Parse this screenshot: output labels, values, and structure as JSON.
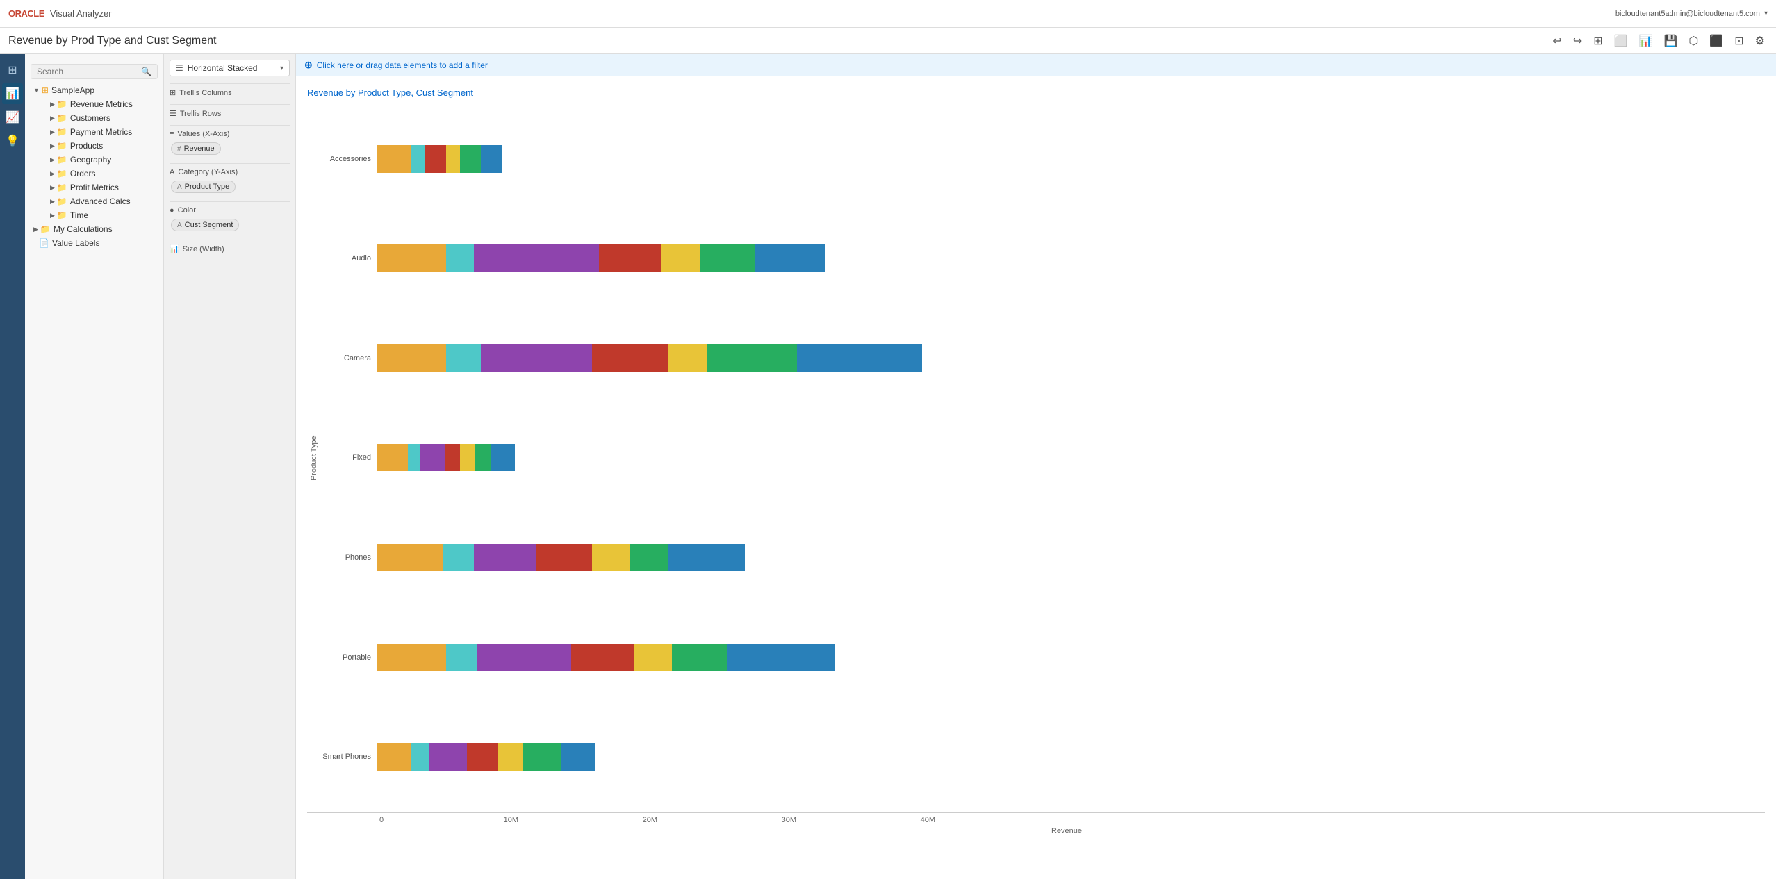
{
  "header": {
    "oracle_label": "ORACLE",
    "app_label": "Visual Analyzer",
    "user_email": "bicloudtenant5admin@bicloudtenant5.com",
    "title": "Revenue by Prod Type and Cust Segment"
  },
  "toolbar_icons": [
    "↩",
    "↪",
    "⊞",
    "⊡",
    "📊",
    "💾",
    "⚙",
    "⬜",
    "⬛",
    "⚙"
  ],
  "filter_bar": {
    "label": "Click here or drag data elements to add a filter"
  },
  "sidebar": {
    "search_placeholder": "Search",
    "root_item": "SampleApp",
    "items": [
      {
        "label": "Revenue Metrics",
        "indent": 1,
        "type": "folder"
      },
      {
        "label": "Customers",
        "indent": 1,
        "type": "folder"
      },
      {
        "label": "Payment Metrics",
        "indent": 1,
        "type": "folder"
      },
      {
        "label": "Products",
        "indent": 1,
        "type": "folder"
      },
      {
        "label": "Geography",
        "indent": 1,
        "type": "folder"
      },
      {
        "label": "Orders",
        "indent": 1,
        "type": "folder"
      },
      {
        "label": "Profit Metrics",
        "indent": 1,
        "type": "folder"
      },
      {
        "label": "Advanced Calcs",
        "indent": 1,
        "type": "folder"
      },
      {
        "label": "Time",
        "indent": 1,
        "type": "folder"
      },
      {
        "label": "My Calculations",
        "indent": 0,
        "type": "folder"
      },
      {
        "label": "Value Labels",
        "indent": 0,
        "type": "item"
      }
    ]
  },
  "grammar": {
    "chart_type": "Horizontal Stacked",
    "sections": [
      {
        "id": "trellis_columns",
        "icon": "⊞",
        "label": "Trellis Columns"
      },
      {
        "id": "trellis_rows",
        "icon": "☰",
        "label": "Trellis Rows"
      },
      {
        "id": "values_xaxis",
        "icon": "≡",
        "label": "Values (X-Axis)",
        "pill": "Revenue",
        "pill_icon": "#"
      },
      {
        "id": "category_yaxis",
        "icon": "A",
        "label": "Category (Y-Axis)",
        "pill": "Product Type",
        "pill_icon": "A"
      },
      {
        "id": "color",
        "icon": "●",
        "label": "Color",
        "pill": "Cust Segment",
        "pill_icon": "A"
      },
      {
        "id": "size_width",
        "icon": "📊",
        "label": "Size (Width)"
      }
    ]
  },
  "chart": {
    "title": "Revenue by Product Type, Cust Segment",
    "y_axis_label": "Product Type",
    "x_axis_label": "Revenue",
    "x_axis_ticks": [
      "0",
      "10M",
      "20M",
      "30M",
      "40M"
    ],
    "rows": [
      {
        "label": "Accessories",
        "segments": [
          {
            "color": "#e8a838",
            "width": 4
          },
          {
            "color": "#4ec8c8",
            "width": 2
          },
          {
            "color": "#c0392b",
            "width": 3
          },
          {
            "color": "#e8c438",
            "width": 2
          },
          {
            "color": "#27ae60",
            "width": 3
          },
          {
            "color": "#2980b9",
            "width": 3
          }
        ]
      },
      {
        "label": "Audio",
        "segments": [
          {
            "color": "#e8a838",
            "width": 9
          },
          {
            "color": "#4ec8c8",
            "width": 3
          },
          {
            "color": "#8e44ad",
            "width": 16
          },
          {
            "color": "#c0392b",
            "width": 8
          },
          {
            "color": "#e8c438",
            "width": 5
          },
          {
            "color": "#27ae60",
            "width": 7
          },
          {
            "color": "#2980b9",
            "width": 9
          }
        ]
      },
      {
        "label": "Camera",
        "segments": [
          {
            "color": "#e8a838",
            "width": 9
          },
          {
            "color": "#4ec8c8",
            "width": 4
          },
          {
            "color": "#8e44ad",
            "width": 14
          },
          {
            "color": "#c0392b",
            "width": 10
          },
          {
            "color": "#e8c438",
            "width": 5
          },
          {
            "color": "#27ae60",
            "width": 12
          },
          {
            "color": "#2980b9",
            "width": 16
          }
        ]
      },
      {
        "label": "Fixed",
        "segments": [
          {
            "color": "#e8a838",
            "width": 4
          },
          {
            "color": "#4ec8c8",
            "width": 2
          },
          {
            "color": "#8e44ad",
            "width": 3
          },
          {
            "color": "#c0392b",
            "width": 2
          },
          {
            "color": "#e8c438",
            "width": 2
          },
          {
            "color": "#27ae60",
            "width": 2
          },
          {
            "color": "#2980b9",
            "width": 3
          }
        ]
      },
      {
        "label": "Phones",
        "segments": [
          {
            "color": "#e8a838",
            "width": 9
          },
          {
            "color": "#4ec8c8",
            "width": 4
          },
          {
            "color": "#8e44ad",
            "width": 8
          },
          {
            "color": "#c0392b",
            "width": 7
          },
          {
            "color": "#e8c438",
            "width": 5
          },
          {
            "color": "#27ae60",
            "width": 5
          },
          {
            "color": "#2980b9",
            "width": 10
          }
        ]
      },
      {
        "label": "Portable",
        "segments": [
          {
            "color": "#e8a838",
            "width": 9
          },
          {
            "color": "#4ec8c8",
            "width": 4
          },
          {
            "color": "#8e44ad",
            "width": 12
          },
          {
            "color": "#c0392b",
            "width": 8
          },
          {
            "color": "#e8c438",
            "width": 5
          },
          {
            "color": "#27ae60",
            "width": 7
          },
          {
            "color": "#2980b9",
            "width": 14
          }
        ]
      },
      {
        "label": "Smart Phones",
        "segments": [
          {
            "color": "#e8a838",
            "width": 4
          },
          {
            "color": "#4ec8c8",
            "width": 2
          },
          {
            "color": "#8e44ad",
            "width": 5
          },
          {
            "color": "#c0392b",
            "width": 4
          },
          {
            "color": "#e8c438",
            "width": 3
          },
          {
            "color": "#27ae60",
            "width": 5
          },
          {
            "color": "#2980b9",
            "width": 4
          }
        ]
      }
    ]
  },
  "left_nav": {
    "icons": [
      {
        "name": "home",
        "symbol": "⊞",
        "active": false
      },
      {
        "name": "data",
        "symbol": "📊",
        "active": true
      },
      {
        "name": "chart",
        "symbol": "📈",
        "active": false
      },
      {
        "name": "lightbulb",
        "symbol": "💡",
        "active": false
      }
    ]
  }
}
